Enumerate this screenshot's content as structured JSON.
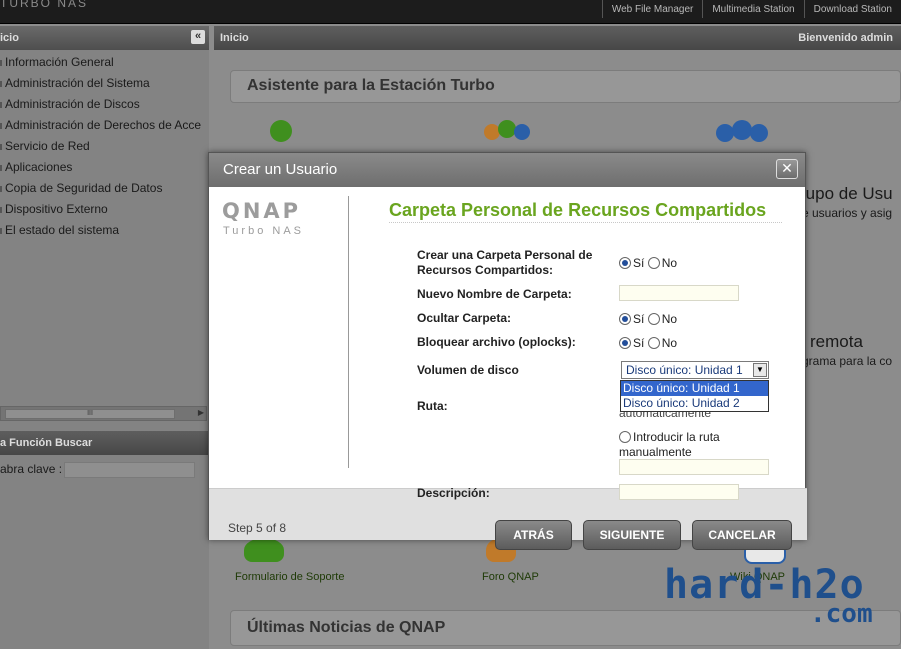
{
  "top": {
    "brand": "TURBO NAS",
    "links": [
      "Web File Manager",
      "Multimedia Station",
      "Download Station"
    ]
  },
  "left": {
    "title": "icio",
    "collapse_icon": "«",
    "menu": [
      "Información General",
      "Administración del Sistema",
      "Administración de Discos",
      "Administración de Derechos de Acce",
      "Servicio de Red",
      "Aplicaciones",
      "Copia de Seguridad de Datos",
      "Dispositivo Externo",
      "El estado del sistema"
    ],
    "scroll_thumb": "III",
    "search_title": "a Función Buscar",
    "search_label": "abra clave :"
  },
  "main": {
    "breadcrumb": "Inicio",
    "welcome": "Bienvenido admin",
    "wizard_title": "Asistente para la Estación Turbo",
    "bg_group_title": "rupo de Usu",
    "bg_group_desc": "e usuarios y asig",
    "bg_remote_title": "remota",
    "bg_remote_desc": "grama para la co",
    "links": [
      "Formulario de Soporte",
      "Foro QNAP",
      "Wiki QNAP"
    ],
    "news_title": "Últimas Noticias de QNAP"
  },
  "watermark": {
    "line1": "hard-h2o",
    "line2": ".com"
  },
  "dialog": {
    "title": "Crear un Usuario",
    "close_icon": "✕",
    "logo": "QNAP",
    "logo_sub": "Turbo NAS",
    "heading": "Carpeta Personal de Recursos Compartidos",
    "fields": {
      "create_label": "Crear una Carpeta Personal de Recursos Compartidos:",
      "name_label": "Nuevo Nombre de Carpeta:",
      "name_value": "",
      "hide_label": "Ocultar Carpeta:",
      "lock_label": "Bloquear archivo (oplocks):",
      "volume_label": "Volumen de disco",
      "path_label": "Ruta:",
      "desc_label": "Descripción:",
      "desc_value": "",
      "yes": "Sí",
      "no": "No",
      "create_choice": "Sí",
      "hide_choice": "Sí",
      "lock_choice": "Sí"
    },
    "volume": {
      "selected": "Disco único: Unidad 1",
      "options": [
        "Disco único: Unidad 1",
        "Disco único: Unidad 2"
      ]
    },
    "path": {
      "auto_text": "automáticamente",
      "manual_text": "Introducir la ruta manualmente",
      "manual_value": ""
    },
    "footer": {
      "step": "Step 5 of 8",
      "back": "ATRÁS",
      "next": "SIGUIENTE",
      "cancel": "CANCELAR"
    }
  }
}
